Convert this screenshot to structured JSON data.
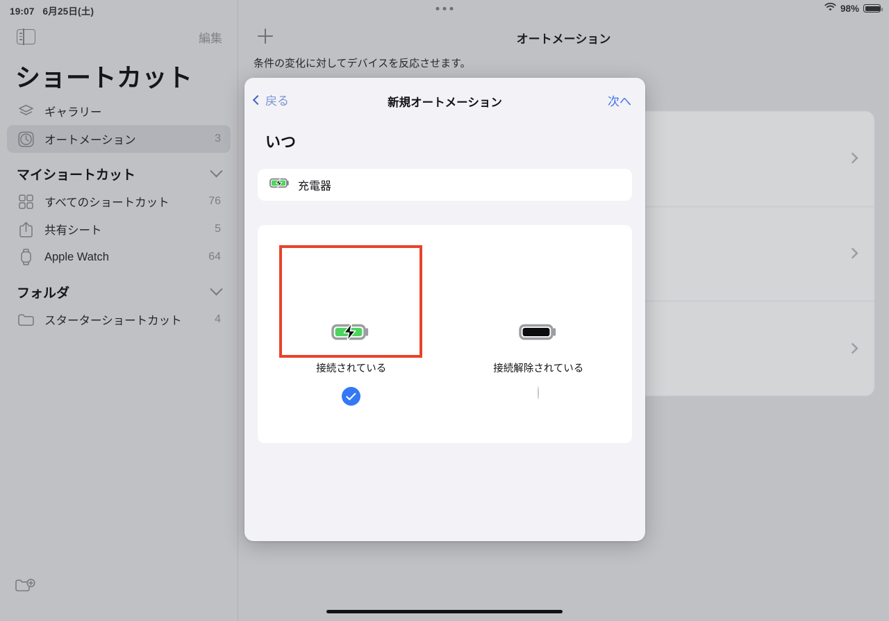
{
  "statusbar": {
    "time": "19:07",
    "date": "6月25日(土)",
    "battery_percent": "98%",
    "wifi_icon": "wifi-icon",
    "battery_icon": "battery-icon",
    "multitask_handle": "three-dots-handle"
  },
  "sidebar": {
    "toggle_icon": "sidebar-toggle-icon",
    "edit_label": "編集",
    "app_title": "ショートカット",
    "items": [
      {
        "label": "ギャラリー",
        "count": "",
        "icon": "gallery-layers-icon",
        "selected": false
      },
      {
        "label": "オートメーション",
        "count": "3",
        "icon": "automation-clock-icon",
        "selected": true
      }
    ],
    "sections": [
      {
        "title": "マイショートカット",
        "chevron": "chevron-down-icon",
        "items": [
          {
            "label": "すべてのショートカット",
            "count": "76",
            "icon": "grid-icon"
          },
          {
            "label": "共有シート",
            "count": "5",
            "icon": "share-icon"
          },
          {
            "label": "Apple Watch",
            "count": "64",
            "icon": "watch-icon"
          }
        ]
      },
      {
        "title": "フォルダ",
        "chevron": "chevron-down-icon",
        "items": [
          {
            "label": "スターターショートカット",
            "count": "4",
            "icon": "folder-icon"
          }
        ]
      }
    ],
    "new_folder_icon": "new-folder-icon"
  },
  "main": {
    "add_icon": "plus-icon",
    "title": "オートメーション",
    "subtitle": "条件の変化に対してデバイスを反応させます。",
    "background_rows": [
      {
        "chevron": "chevron-right-icon"
      },
      {
        "chevron": "chevron-right-icon"
      },
      {
        "chevron": "chevron-right-icon"
      }
    ]
  },
  "sheet": {
    "back_label": "戻る",
    "back_icon": "chevron-left-icon",
    "title": "新規オートメーション",
    "next_label": "次へ",
    "when_label": "いつ",
    "trigger": {
      "name": "充電器",
      "icon": "battery-charging-icon"
    },
    "options": [
      {
        "label": "接続されている",
        "icon": "battery-charging-icon",
        "selected": true,
        "radio_icon": "check-circle-filled-icon"
      },
      {
        "label": "接続解除されている",
        "icon": "battery-full-black-icon",
        "selected": false,
        "radio_icon": "circle-outline-icon"
      }
    ]
  },
  "annotation": {
    "highlight_color": "#e8432a",
    "target": "接続されている"
  },
  "colors": {
    "accent_blue": "#3478f6",
    "link_blue": "#3f72e8",
    "battery_green": "#4cd45f",
    "sidebar_bg": "#c0c1c5",
    "sheet_bg": "#f2f2f7"
  }
}
